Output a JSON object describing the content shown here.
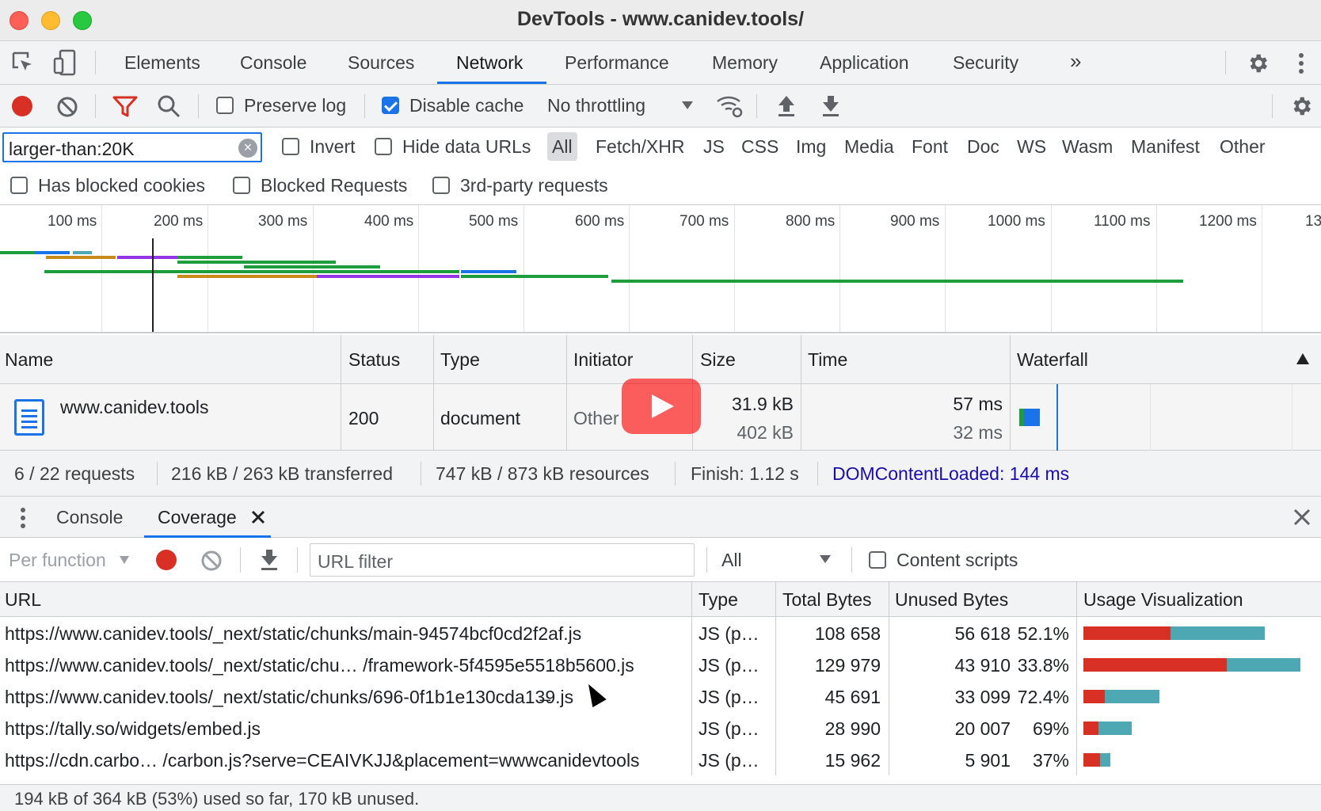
{
  "window": {
    "title": "DevTools - www.canidev.tools/"
  },
  "main_tabs": [
    "Elements",
    "Console",
    "Sources",
    "Network",
    "Performance",
    "Memory",
    "Application",
    "Security"
  ],
  "main_tabs_more": "»",
  "network_toolbar": {
    "preserve_log": {
      "label": "Preserve log",
      "checked": false
    },
    "disable_cache": {
      "label": "Disable cache",
      "checked": true
    },
    "throttling": "No throttling"
  },
  "filter": {
    "value": "larger-than:20K",
    "invert": "Invert",
    "hide_data_urls": "Hide data URLs",
    "types": [
      "All",
      "Fetch/XHR",
      "JS",
      "CSS",
      "Img",
      "Media",
      "Font",
      "Doc",
      "WS",
      "Wasm",
      "Manifest",
      "Other"
    ],
    "active_type": "All",
    "has_blocked_cookies": "Has blocked cookies",
    "blocked_requests": "Blocked Requests",
    "third_party": "3rd-party requests"
  },
  "overview": {
    "ticks": [
      "100 ms",
      "200 ms",
      "300 ms",
      "400 ms",
      "500 ms",
      "600 ms",
      "700 ms",
      "800 ms",
      "900 ms",
      "1000 ms",
      "1100 ms",
      "1200 ms",
      "13"
    ]
  },
  "requests": {
    "columns": [
      "Name",
      "Status",
      "Type",
      "Initiator",
      "Size",
      "Time",
      "Waterfall"
    ],
    "rows": [
      {
        "name": "www.canidev.tools",
        "status": "200",
        "type": "document",
        "initiator": "Other",
        "size_transferred": "31.9 kB",
        "size_resource": "402 kB",
        "time_total": "57 ms",
        "time_latency": "32 ms"
      }
    ]
  },
  "summary": {
    "requests": "6 / 22 requests",
    "transferred": "216 kB / 263 kB transferred",
    "resources": "747 kB / 873 kB resources",
    "finish": "Finish: 1.12 s",
    "dom_content_loaded": "DOMContentLoaded: 144 ms"
  },
  "drawer": {
    "tabs": [
      "Console",
      "Coverage"
    ],
    "active_tab": "Coverage"
  },
  "coverage": {
    "per_function": "Per function",
    "url_filter_placeholder": "URL filter",
    "type_filter": "All",
    "content_scripts": "Content scripts",
    "columns": [
      "URL",
      "Type",
      "Total Bytes",
      "Unused Bytes",
      "Usage Visualization"
    ],
    "rows": [
      {
        "url": "https://www.canidev.tools/_next/static/chunks/main-94574bcf0cd2f2af.js",
        "type": "JS (p…",
        "total": "108 658",
        "unused": "56 618",
        "pct": "52.1%",
        "total_num": 108658,
        "unused_num": 56618
      },
      {
        "url": "https://www.canidev.tools/_next/static/chu…  /framework-5f4595e5518b5600.js",
        "type": "JS (p…",
        "total": "129 979",
        "unused": "43 910",
        "pct": "33.8%",
        "total_num": 129979,
        "unused_num": 43910
      },
      {
        "url": "https://www.canidev.tools/_next/static/chunks/696-0f1b1e130cda13̶9.js",
        "type": "JS (p…",
        "total": "45 691",
        "unused": "33 099",
        "pct": "72.4%",
        "total_num": 45691,
        "unused_num": 33099
      },
      {
        "url": "https://tally.so/widgets/embed.js",
        "type": "JS (p…",
        "total": "28 990",
        "unused": "20 007",
        "pct": "69%",
        "total_num": 28990,
        "unused_num": 20007
      },
      {
        "url": "https://cdn.carbo…  /carbon.js?serve=CEAIVKJJ&placement=wwwcanidevtools",
        "type": "JS (p…",
        "total": "15 962",
        "unused": "5 901",
        "pct": "37%",
        "total_num": 15962,
        "unused_num": 5901
      }
    ],
    "status": "194 kB of 364 kB (53%) used so far, 170 kB unused."
  },
  "colors": {
    "accent": "#1a73e8",
    "used": "#d93025",
    "unused": "#4ea8b3",
    "record": "#d93025"
  }
}
